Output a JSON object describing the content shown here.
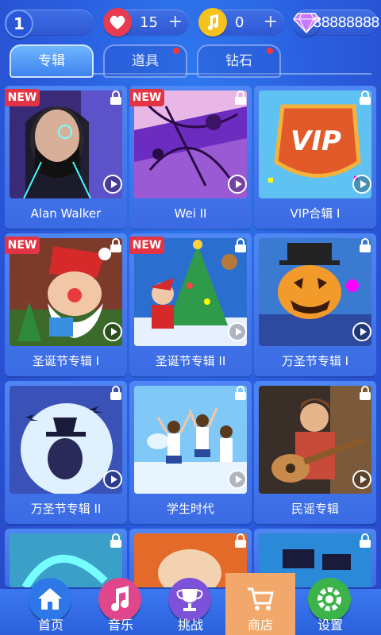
{
  "topbar": {
    "level": "1",
    "hearts": "15",
    "notes": "0",
    "gems": "88888888"
  },
  "tabs": [
    {
      "label": "专辑",
      "active": true
    },
    {
      "label": "道具",
      "active": false,
      "dot": true
    },
    {
      "label": "钻石",
      "active": false,
      "dot": true
    }
  ],
  "albums": [
    {
      "title": "Alan Walker",
      "new": true,
      "icon": "alan-walker-cover"
    },
    {
      "title": "Wei II",
      "new": true,
      "icon": "abstract-ink-cover"
    },
    {
      "title": "VIP合辑 I",
      "new": false,
      "icon": "vip-badge-cover"
    },
    {
      "title": "圣诞节专辑 I",
      "new": true,
      "icon": "santa-cover"
    },
    {
      "title": "圣诞节专辑 II",
      "new": true,
      "icon": "christmas-tree-cover"
    },
    {
      "title": "万圣节专辑 I",
      "new": false,
      "icon": "pumpkin-cover"
    },
    {
      "title": "万圣节专辑 II",
      "new": false,
      "icon": "moon-witch-cover"
    },
    {
      "title": "学生时代",
      "new": false,
      "icon": "students-jumping-cover"
    },
    {
      "title": "民谣专辑",
      "new": false,
      "icon": "guitar-player-cover"
    }
  ],
  "nav": [
    {
      "label": "首页",
      "icon": "home-icon",
      "color": "#2d77e8"
    },
    {
      "label": "音乐",
      "icon": "music-note-icon",
      "color": "#e0468b"
    },
    {
      "label": "挑战",
      "icon": "trophy-icon",
      "color": "#7b52d8"
    },
    {
      "label": "商店",
      "icon": "shopping-cart-icon",
      "color": "#f2a86b",
      "active": true
    },
    {
      "label": "设置",
      "icon": "gear-icon",
      "color": "#3cb34a"
    }
  ]
}
